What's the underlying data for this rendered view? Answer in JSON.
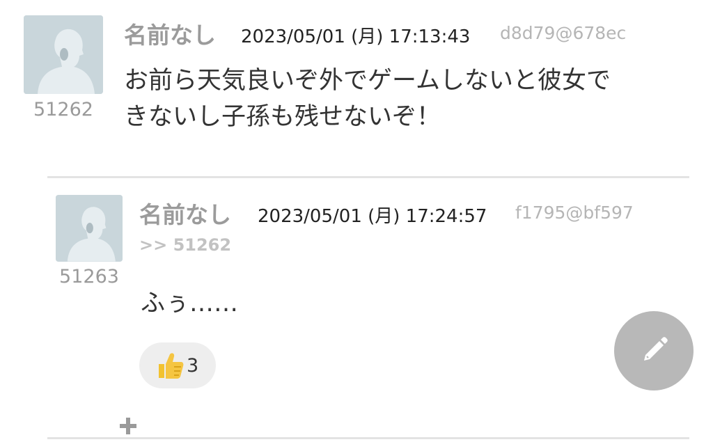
{
  "posts": [
    {
      "id": "51262",
      "name": "名前なし",
      "date": "2023/05/01 (月) 17:13:43",
      "uid": "d8d79@678ec",
      "body_line1": "お前ら天気良いぞ外でゲームしないと彼女で",
      "body_line2": "きないし子孫も残せないぞ！"
    }
  ],
  "reply": {
    "id": "51263",
    "name": "名前なし",
    "date": "2023/05/01 (月) 17:24:57",
    "uid": "f1795@bf597",
    "reply_to": ">> 51262",
    "body": "ふぅ……",
    "reaction": {
      "icon": "thumbs-up-icon",
      "count": "3"
    }
  },
  "icons": {
    "add": "plus-icon",
    "compose": "pencil-icon"
  },
  "colors": {
    "avatar_bg": "#c9d6db",
    "fab_bg": "#b8b8b8",
    "reaction_bg": "#eeeeee"
  }
}
